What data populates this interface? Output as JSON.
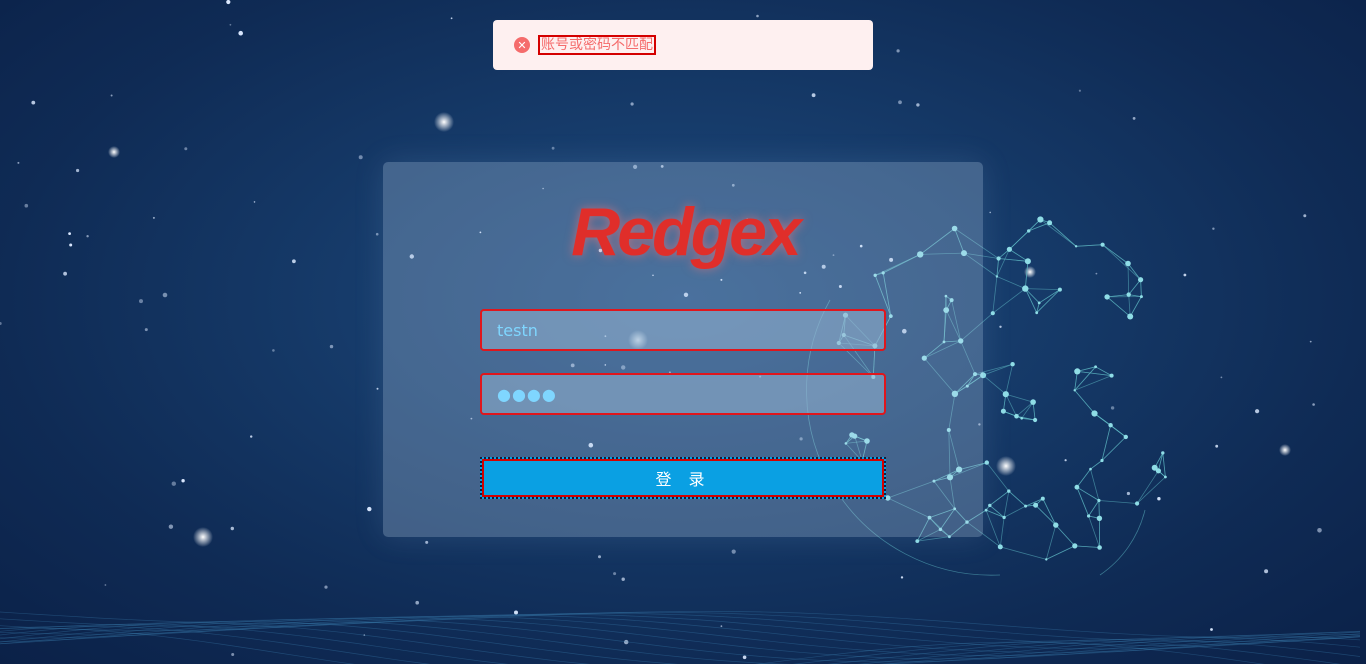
{
  "toast": {
    "type": "error",
    "icon": "error-circle-icon",
    "message": "账号或密码不匹配"
  },
  "login": {
    "logo_text": "Redgex",
    "username_value": "testn",
    "password_masked": "●●●●",
    "submit_label": "登 录"
  },
  "colors": {
    "background": "#163b6a",
    "accent_blue": "#0aa0e3",
    "logo_red": "#e02e2a",
    "error_red": "#f56c6c",
    "toast_bg": "#fef0f0"
  }
}
